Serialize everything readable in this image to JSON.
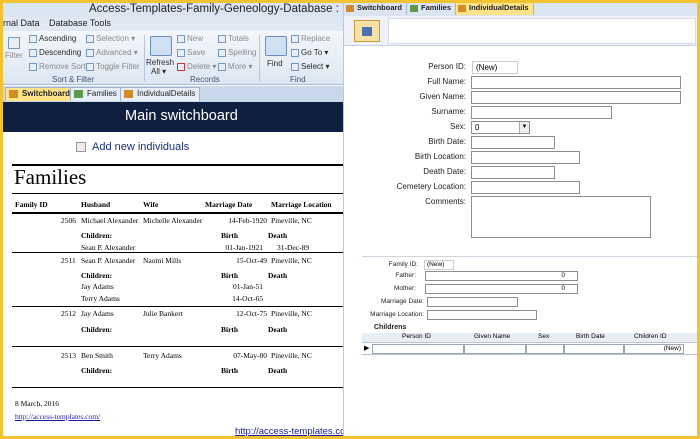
{
  "window": {
    "title": "Access-Templates-Family-Geneology-Database : Database (A"
  },
  "ribbon": {
    "tabs": [
      "rnal Data",
      "Database Tools"
    ],
    "sort_filter": {
      "filter": "Filter",
      "ascending": "Ascending",
      "descending": "Descending",
      "remove_sort": "Remove Sort",
      "selection": "Selection ▾",
      "advanced": "Advanced ▾",
      "toggle_filter": "Toggle Filter",
      "group": "Sort & Filter"
    },
    "records": {
      "refresh": "Refresh",
      "refresh_all": "All ▾",
      "new": "New",
      "save": "Save",
      "delete": "Delete ▾",
      "totals": "Totals",
      "spelling": "Spelling",
      "more": "More ▾",
      "group": "Records"
    },
    "find": {
      "find": "Find",
      "replace": "Replace",
      "goto": "Go To ▾",
      "select": "Select ▾",
      "group": "Find"
    }
  },
  "doc_tabs": [
    "Switchboard",
    "Families",
    "IndividualDetails"
  ],
  "switchboard": {
    "title": "Main switchboard",
    "add_individuals": "Add new individuals"
  },
  "report": {
    "title": "Families",
    "columns": [
      "Family ID",
      "Husband",
      "Wife",
      "Marriage Date",
      "Marriage Location"
    ],
    "children_label": "Children:",
    "birth_label": "Birth",
    "death_label": "Death",
    "families": [
      {
        "id": "2506",
        "husband": "Michael Alexander",
        "wife": "Michelle Alexander",
        "date": "14-Feb-1920",
        "location": "Pineville, NC",
        "children": [
          {
            "name": "Sean P. Alexander",
            "birth": "01-Jan-1921",
            "death": "31-Dec-89"
          }
        ]
      },
      {
        "id": "2511",
        "husband": "Sean P. Alexander",
        "wife": "Naomi Mills",
        "date": "15-Oct-49",
        "location": "Pineville, NC",
        "children": [
          {
            "name": "Jay Adams",
            "birth": "01-Jan-51",
            "death": ""
          },
          {
            "name": "Terry Adams",
            "birth": "14-Oct-65",
            "death": ""
          }
        ]
      },
      {
        "id": "2512",
        "husband": "Jay Adams",
        "wife": "Julie Bankert",
        "date": "12-Oct-75",
        "location": "Pineville, NC",
        "children": []
      },
      {
        "id": "2513",
        "husband": "Ben Smith",
        "wife": "Terry Adams",
        "date": "07-May-80",
        "location": "Pineville, NC",
        "children": []
      }
    ],
    "printed_date": "8 March, 2016",
    "url": "http://access-templates.com/"
  },
  "footer_url": "http://access-templates.com/",
  "form": {
    "tabs": [
      "Switchboard",
      "Families",
      "IndividualDetails"
    ],
    "fields": {
      "person_id": {
        "label": "Person ID:",
        "value": "(New)"
      },
      "full_name": {
        "label": "Full Name:",
        "value": ""
      },
      "given_name": {
        "label": "Given Name:",
        "value": ""
      },
      "surname": {
        "label": "Surname:",
        "value": ""
      },
      "sex": {
        "label": "Sex:",
        "value": "0"
      },
      "birth_date": {
        "label": "Birth Date:",
        "value": ""
      },
      "birth_location": {
        "label": "Birth Location:",
        "value": ""
      },
      "death_date": {
        "label": "Death Date:",
        "value": ""
      },
      "cemetery_location": {
        "label": "Cemetery Location:",
        "value": ""
      },
      "comments": {
        "label": "Comments:",
        "value": ""
      }
    },
    "family": {
      "family_id": {
        "label": "Family ID:",
        "value": "(New)"
      },
      "father": {
        "label": "Father:",
        "value": "0"
      },
      "mother": {
        "label": "Mother:",
        "value": "0"
      },
      "marriage_date": {
        "label": "Marriage Date:",
        "value": ""
      },
      "marriage_location": {
        "label": "Marriage Location:",
        "value": ""
      }
    },
    "children": {
      "heading": "Childrens",
      "columns": [
        "Person ID",
        "Given Name",
        "Sex",
        "Birth Date",
        "Children ID"
      ],
      "new_row_id": "(New)"
    }
  }
}
